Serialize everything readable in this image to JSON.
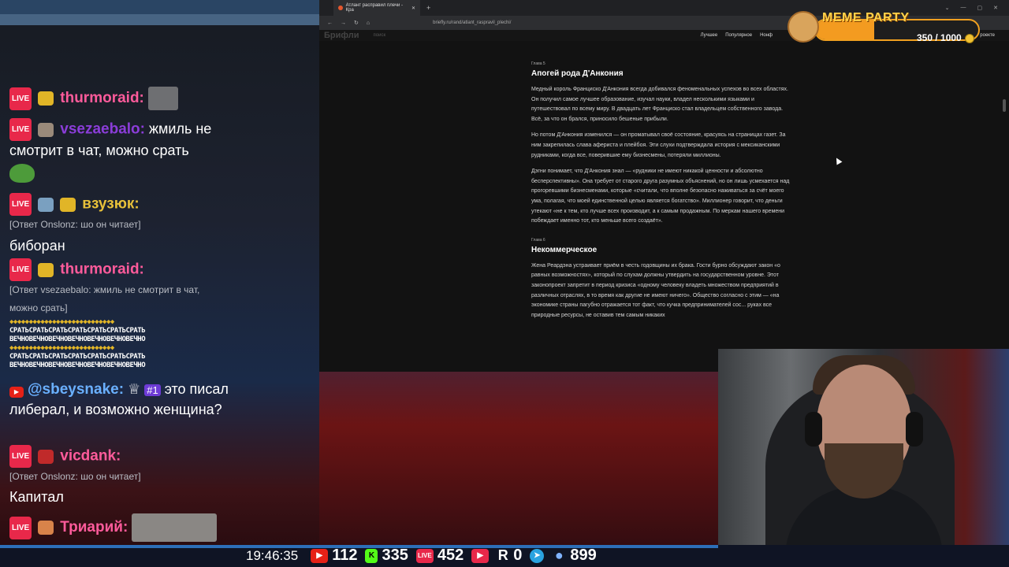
{
  "chat": {
    "messages": [
      {
        "user": "thurmoraid:",
        "user_color": "#ff5b9b",
        "text": ""
      },
      {
        "user": "vsezaebalo:",
        "user_color": "#8b3dd9",
        "text": "жмиль не смотрит в чат, можно срать"
      },
      {
        "user": "взузюк:",
        "user_color": "#e8c13a",
        "reply": "[Ответ Onslonz: шо он читает]",
        "text": "биборан"
      },
      {
        "user": "thurmoraid:",
        "user_color": "#ff5b9b",
        "reply": "[Ответ vsezaebalo: жмиль не смотрит в чат, можно срать]"
      },
      {
        "user": "@sbeysnake:",
        "user_color": "#6ab0ff",
        "rank": "#1",
        "text": "это писал либерал, и возможно женщина?"
      },
      {
        "user": "vicdank:",
        "user_color": "#ff5b9b",
        "reply": "[Ответ Onslonz: шо он читает]",
        "text": "Капитал"
      },
      {
        "user": "Триарий:",
        "user_color": "#ff5b9b",
        "text": ""
      }
    ],
    "live_label": "LIVE",
    "spam_line_1": "СРАТЬСРАТЬСРАТЬСРАТЬСРАТЬСРАТЬСРАТЬ",
    "spam_line_2": "ВЕЧНОВЕЧНОВЕЧНОВЕЧНОВЕЧНОВЕЧНОВЕЧНО"
  },
  "browser": {
    "tab_title": "Атлант расправил плечи - Кра",
    "url": "briefly.ru/rand/atlant_raspravil_plechi/",
    "site_logo": "Брифли",
    "search_placeholder": "поиск",
    "nav": [
      "Лучшее",
      "Популярное",
      "Нонф"
    ],
    "nav_right": "роекте",
    "chapter5_label": "Глава 5",
    "chapter5_title": "Апогей рода Д'Анкония",
    "p1": "Медный король Франциско Д'Анкония всегда добивался феноменальных успехов во всех областях. Он получил самое лучшее образование, изучал науки, владел несколькими языками и путешествовал по всему миру. В двадцать лет Франциско стал владельцем собственного завода. Всё, за что он брался, приносило бешеные прибыли.",
    "p2": "Но потом Д'Анкония изменился — он проматывал своё состояние, красуясь на страницах газет. За ним закрепилась слава афериста и плейбоя. Эти слухи подтверждала история с мексиканскими рудниками, когда все, поверившие ему бизнесмены, потеряли миллионы.",
    "p3": "Дэгни понимает, что Д'Анкония знал — «рудники не имеют никакой ценности и абсолютно бесперспективны». Она требует от старого друга разумных объяснений, но он лишь усмехается над прогоревшими бизнесменами, которые «считали, что вполне безопасно наживаться за счёт моего ума, полагая, что моей единственной целью является богатство». Миллионер говорит, что деньги утекают «не к тем, кто лучше всех производит, а к самым продажным. По меркам нашего времени побеждает именно тот, кто меньше всего создаёт».",
    "chapter6_label": "Глава 6",
    "chapter6_title": "Некоммерческое",
    "p4": "Жена Реардэна устраивает приём в честь годовщины их брака. Гости бурно обсуждают закон «о равных возможностях», который по слухам должны утвердить на государственном уровне. Этот законопроект запретит в период кризиса «одному человеку владеть множеством предприятий в различных отраслях, в то время как другие не имеют ничего». Общество согласно с этим — «на экономике страны пагубно отражается тот факт, что кучка предпринимателей сос... руках все природные ресурсы, не оставив тем самым никаких"
  },
  "meme_party": {
    "title": "MEME PARTY",
    "progress_text": "350 / 1000",
    "progress_fraction": 0.35
  },
  "stats": {
    "clock": "19:46:35",
    "youtube": "112",
    "kick": "335",
    "vk_live": "452",
    "vk_video": "",
    "rutube": "0",
    "telegram": "",
    "viewers": "899",
    "kick_letter": "K",
    "rutube_letter": "R",
    "vk_label": "LIVE"
  }
}
